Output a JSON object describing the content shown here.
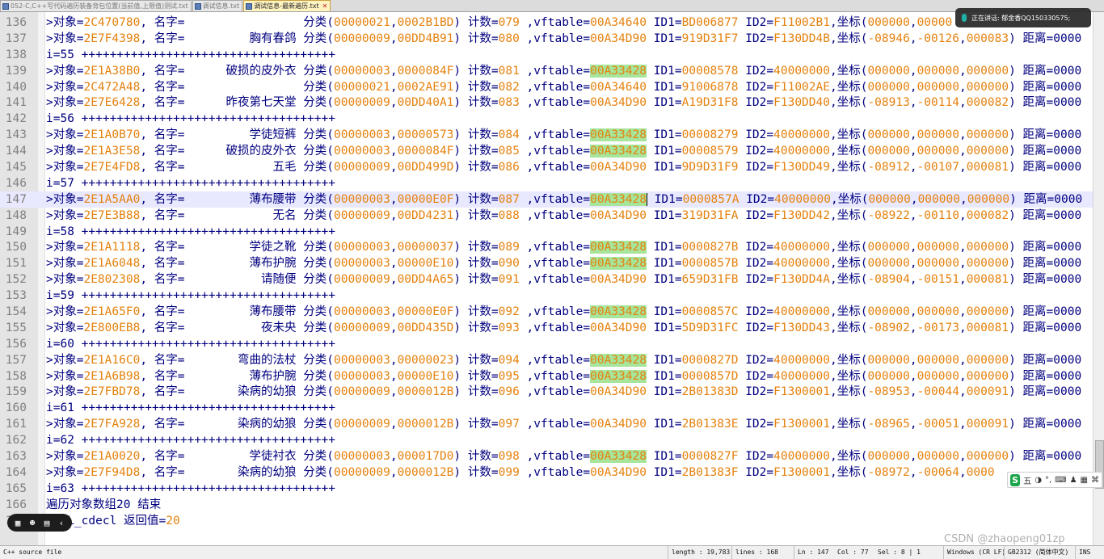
{
  "tabs": [
    {
      "label": "052-C,C++写代码遍历装备背包位置(当前值,上限值)测试.txt",
      "active": false
    },
    {
      "label": "调试信息.txt",
      "active": false
    },
    {
      "label": "调试信息-最新遍历.txt",
      "active": true
    }
  ],
  "lines": [
    {
      "n": "136",
      "obj": "2C470780",
      "name": "",
      "c1": "00000021",
      "c2": "0002B1BD",
      "cnt": "079",
      "vft": "00A34640",
      "hl": false,
      "id1": "BD006877",
      "id2": "F11002B1",
      "x": "000000",
      "y": "00000",
      "z": "",
      "tail": ""
    },
    {
      "n": "137",
      "obj": "2E7F4398",
      "name": "胸有春鸽",
      "c1": "00000009",
      "c2": "00DD4B91",
      "cnt": "080",
      "vft": "00A34D90",
      "hl": false,
      "id1": "919D31F7",
      "id2": "F130DD4B",
      "x": "-08946",
      "y": "-00126",
      "z": "000083",
      "tail": " 距离=0000"
    },
    {
      "n": "138",
      "sep": "i=55"
    },
    {
      "n": "139",
      "obj": "2E1A38B0",
      "name": "破损的皮外衣",
      "c1": "00000003",
      "c2": "0000084F",
      "cnt": "081",
      "vft": "00A33428",
      "hl": true,
      "id1": "00008578",
      "id2": "40000000",
      "x": "000000",
      "y": "000000",
      "z": "000000",
      "tail": " 距离=0000"
    },
    {
      "n": "140",
      "obj": "2C472A48",
      "name": "",
      "c1": "00000021",
      "c2": "0002AE91",
      "cnt": "082",
      "vft": "00A34640",
      "hl": false,
      "id1": "91006878",
      "id2": "F11002AE",
      "x": "000000",
      "y": "000000",
      "z": "000000",
      "tail": " 距离=0000"
    },
    {
      "n": "141",
      "obj": "2E7E6428",
      "name": "昨夜第七天堂",
      "c1": "00000009",
      "c2": "00DD40A1",
      "cnt": "083",
      "vft": "00A34D90",
      "hl": false,
      "id1": "A19D31F8",
      "id2": "F130DD40",
      "x": "-08913",
      "y": "-00114",
      "z": "000082",
      "tail": " 距离=0000"
    },
    {
      "n": "142",
      "sep": "i=56"
    },
    {
      "n": "143",
      "obj": "2E1A0B70",
      "name": "学徒短裤",
      "c1": "00000003",
      "c2": "00000573",
      "cnt": "084",
      "vft": "00A33428",
      "hl": true,
      "id1": "00008279",
      "id2": "40000000",
      "x": "000000",
      "y": "000000",
      "z": "000000",
      "tail": " 距离=0000"
    },
    {
      "n": "144",
      "obj": "2E1A3E58",
      "name": "破损的皮外衣",
      "c1": "00000003",
      "c2": "0000084F",
      "cnt": "085",
      "vft": "00A33428",
      "hl": true,
      "id1": "00008579",
      "id2": "40000000",
      "x": "000000",
      "y": "000000",
      "z": "000000",
      "tail": " 距离=0000"
    },
    {
      "n": "145",
      "obj": "2E7E4FD8",
      "name": "五毛",
      "c1": "00000009",
      "c2": "00DD499D",
      "cnt": "086",
      "vft": "00A34D90",
      "hl": false,
      "id1": "9D9D31F9",
      "id2": "F130DD49",
      "x": "-08912",
      "y": "-00107",
      "z": "000081",
      "tail": " 距离=0000"
    },
    {
      "n": "146",
      "sep": "i=57"
    },
    {
      "n": "147",
      "obj": "2E1A5AA0",
      "name": "薄布腰带",
      "c1": "00000003",
      "c2": "00000E0F",
      "cnt": "087",
      "vft": "00A33428",
      "hl": true,
      "id1": "0000857A",
      "id2": "40000000",
      "x": "000000",
      "y": "000000",
      "z": "000000",
      "tail": " 距离=0000",
      "current": true
    },
    {
      "n": "148",
      "obj": "2E7E3B88",
      "name": "无名",
      "c1": "00000009",
      "c2": "00DD4231",
      "cnt": "088",
      "vft": "00A34D90",
      "hl": false,
      "id1": "319D31FA",
      "id2": "F130DD42",
      "x": "-08922",
      "y": "-00110",
      "z": "000082",
      "tail": " 距离=0000"
    },
    {
      "n": "149",
      "sep": "i=58"
    },
    {
      "n": "150",
      "obj": "2E1A1118",
      "name": "学徒之靴",
      "c1": "00000003",
      "c2": "00000037",
      "cnt": "089",
      "vft": "00A33428",
      "hl": true,
      "id1": "0000827B",
      "id2": "40000000",
      "x": "000000",
      "y": "000000",
      "z": "000000",
      "tail": " 距离=0000"
    },
    {
      "n": "151",
      "obj": "2E1A6048",
      "name": "薄布护腕",
      "c1": "00000003",
      "c2": "00000E10",
      "cnt": "090",
      "vft": "00A33428",
      "hl": true,
      "id1": "0000857B",
      "id2": "40000000",
      "x": "000000",
      "y": "000000",
      "z": "000000",
      "tail": " 距离=0000"
    },
    {
      "n": "152",
      "obj": "2E802308",
      "name": "请随便",
      "c1": "00000009",
      "c2": "00DD4A65",
      "cnt": "091",
      "vft": "00A34D90",
      "hl": false,
      "id1": "659D31FB",
      "id2": "F130DD4A",
      "x": "-08904",
      "y": "-00151",
      "z": "000081",
      "tail": " 距离=0000"
    },
    {
      "n": "153",
      "sep": "i=59"
    },
    {
      "n": "154",
      "obj": "2E1A65F0",
      "name": "薄布腰带",
      "c1": "00000003",
      "c2": "00000E0F",
      "cnt": "092",
      "vft": "00A33428",
      "hl": true,
      "id1": "0000857C",
      "id2": "40000000",
      "x": "000000",
      "y": "000000",
      "z": "000000",
      "tail": " 距离=0000"
    },
    {
      "n": "155",
      "obj": "2E800EB8",
      "name": "夜未央",
      "c1": "00000009",
      "c2": "00DD435D",
      "cnt": "093",
      "vft": "00A34D90",
      "hl": false,
      "id1": "5D9D31FC",
      "id2": "F130DD43",
      "x": "-08902",
      "y": "-00173",
      "z": "000081",
      "tail": " 距离=0000"
    },
    {
      "n": "156",
      "sep": "i=60"
    },
    {
      "n": "157",
      "obj": "2E1A16C0",
      "name": "弯曲的法杖",
      "c1": "00000003",
      "c2": "00000023",
      "cnt": "094",
      "vft": "00A33428",
      "hl": true,
      "id1": "0000827D",
      "id2": "40000000",
      "x": "000000",
      "y": "000000",
      "z": "000000",
      "tail": " 距离=0000"
    },
    {
      "n": "158",
      "obj": "2E1A6B98",
      "name": "薄布护腕",
      "c1": "00000003",
      "c2": "00000E10",
      "cnt": "095",
      "vft": "00A33428",
      "hl": true,
      "id1": "0000857D",
      "id2": "40000000",
      "x": "000000",
      "y": "000000",
      "z": "000000",
      "tail": " 距离=0000"
    },
    {
      "n": "159",
      "obj": "2E7FBD78",
      "name": "染病的幼狼",
      "c1": "00000009",
      "c2": "0000012B",
      "cnt": "096",
      "vft": "00A34D90",
      "hl": false,
      "id1": "2B01383D",
      "id2": "F1300001",
      "x": "-08953",
      "y": "-00044",
      "z": "000091",
      "tail": " 距离=0000"
    },
    {
      "n": "160",
      "sep": "i=61"
    },
    {
      "n": "161",
      "obj": "2E7FA928",
      "name": "染病的幼狼",
      "c1": "00000009",
      "c2": "0000012B",
      "cnt": "097",
      "vft": "00A34D90",
      "hl": false,
      "id1": "2B01383E",
      "id2": "F1300001",
      "x": "-08965",
      "y": "-00051",
      "z": "000091",
      "tail": " 距离=0000"
    },
    {
      "n": "162",
      "sep": "i=62"
    },
    {
      "n": "163",
      "obj": "2E1A0020",
      "name": "学徒衬衣",
      "c1": "00000003",
      "c2": "000017D0",
      "cnt": "098",
      "vft": "00A33428",
      "hl": true,
      "id1": "0000827F",
      "id2": "40000000",
      "x": "000000",
      "y": "000000",
      "z": "000000",
      "tail": " 距离=0000"
    },
    {
      "n": "164",
      "obj": "2E7F94D8",
      "name": "染病的幼狼",
      "c1": "00000009",
      "c2": "0000012B",
      "cnt": "099",
      "vft": "00A34D90",
      "hl": false,
      "id1": "2B01383F",
      "id2": "F1300001",
      "x": "-08972",
      "y": "-00064",
      "z": "0000",
      "tail": ""
    },
    {
      "n": "165",
      "sep": "i=63"
    },
    {
      "n": "166",
      "plain": "遍历对象数组20 结束"
    },
    {
      "n": "167",
      "plain": "CALL_cdecl 返回值=",
      "num": "20"
    }
  ],
  "labels": {
    "obj": ">对象=",
    "name": ", 名字=",
    "cls": " 分类(",
    "cnt": " 计数=",
    "vft": " ,vftable=",
    "id1": " ID1=",
    "id2": " ID2=",
    "coord": ",坐标("
  },
  "sep_plus": " ++++++++++++++++++++++++++++++++++++",
  "status": {
    "filetype": "C++ source file",
    "length": "length : 19,783",
    "lines": "lines : 168",
    "ln": "Ln : 147",
    "col": "Col : 77",
    "sel": "Sel : 8 | 1",
    "eol": "Windows (CR LF)",
    "enc": "GB2312 (简体中文)",
    "mode": "INS"
  },
  "speaking": {
    "text": "正在讲话: 郁金香QQ150330575;"
  },
  "ime": {
    "logo": "S",
    "label": "五",
    "icons": [
      "moon-icon",
      "dot-icon",
      "keyboard-icon",
      "person-icon",
      "grid-icon",
      "shirt-icon"
    ]
  },
  "watermark": "CSDN @zhaopeng01zp",
  "colors": {
    "hex": "#e5820f",
    "text": "#000080",
    "highlight": "#a6e59a",
    "current_line": "#e8e8ff"
  }
}
